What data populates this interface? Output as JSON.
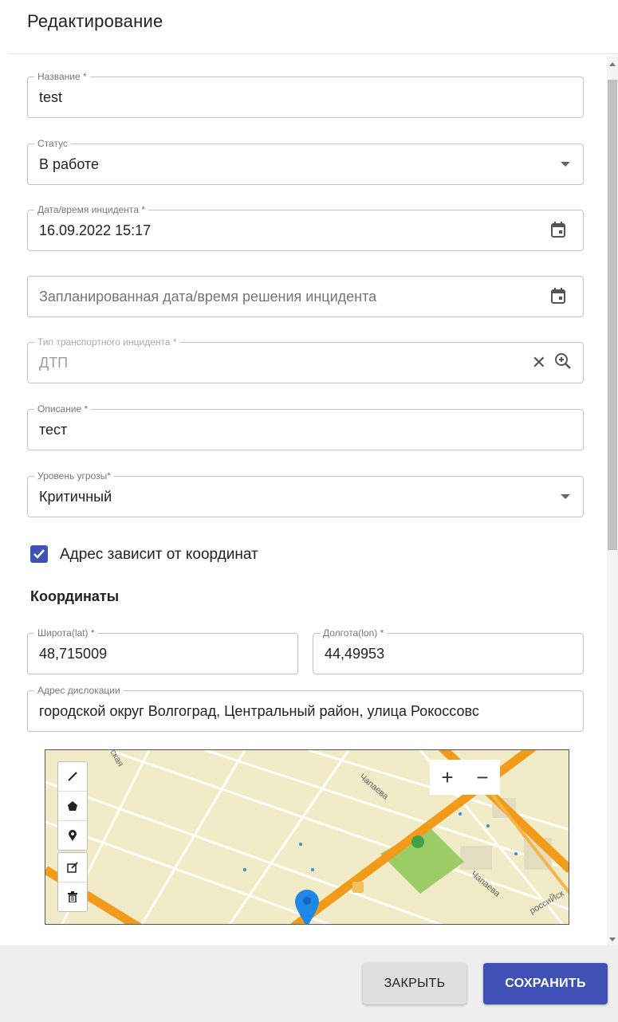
{
  "dialog": {
    "title": "Редактирование"
  },
  "fields": {
    "name": {
      "label": "Название *",
      "value": "test"
    },
    "status": {
      "label": "Статус",
      "value": "В работе"
    },
    "incident_datetime": {
      "label": "Дата/время инцидента *",
      "value": "16.09.2022 15:17"
    },
    "planned_datetime": {
      "placeholder": "Запланированная дата/время решения инцидента"
    },
    "incident_type": {
      "label": "Тип транспортного инцидента *",
      "value": "ДТП"
    },
    "description": {
      "label": "Описание *",
      "value": "тест"
    },
    "threat_level": {
      "label": "Уровень угрозы*",
      "value": "Критичный"
    },
    "latitude": {
      "label": "Широта(lat) *",
      "value": "48,715009"
    },
    "longitude": {
      "label": "Долгота(lon) *",
      "value": "44,49953"
    },
    "address": {
      "label": "Адрес дислокации",
      "value": "городской округ Волгоград, Центральный район, улица Рокоссовс"
    }
  },
  "checkbox": {
    "label": "Адрес зависит от координат",
    "checked": true
  },
  "section": {
    "coordinates_title": "Координаты"
  },
  "map": {
    "street_labels": [
      "Чапаева",
      "Чапаева",
      "ская",
      "россиЙск"
    ],
    "zoom_in": "+",
    "zoom_out": "−",
    "tools": [
      "line-tool-icon",
      "polygon-tool-icon",
      "marker-tool-icon",
      "edit-icon",
      "trash-icon"
    ]
  },
  "footer": {
    "close_label": "ЗАКРЫТЬ",
    "save_label": "СОХРАНИТЬ"
  },
  "colors": {
    "accent": "#3f51b5",
    "road": "#f29b1b",
    "map_bg": "#f1ebc8",
    "park": "#9ccc65",
    "marker": "#1e88e5"
  }
}
